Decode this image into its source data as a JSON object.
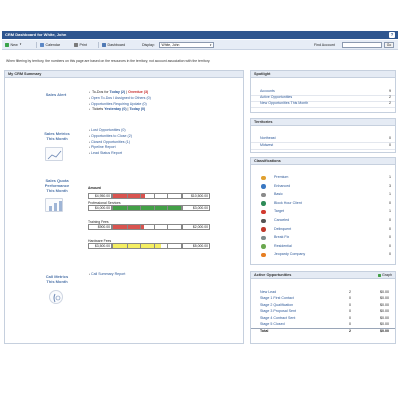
{
  "window": {
    "title": "CRM Dashboard for White, John"
  },
  "toolbar": {
    "new_label": "New",
    "calendar_label": "Calendar",
    "print_label": "Print",
    "dashboard_label": "Dashboard",
    "display_label": "Display:",
    "display_value": "White, John",
    "find_account_label": "Find Account",
    "find_account_value": "",
    "go_label": "Go"
  },
  "notice": "When filtering by territory, the numbers on this page are based on the resources in the territory, not account association with the territory.",
  "summary": {
    "title": "My CRM Summary",
    "sales_alert": {
      "title": "Sales Alert",
      "todo_label": "To-Dos for",
      "today_text": "Today (2)",
      "overdue_text": "Overdue (3)",
      "items": [
        "Open To-Dos I Assigned to Others (0)",
        "Opportunities Requiring Update (0)"
      ],
      "tickets_label": "Tickets",
      "tickets_yesterday": "Yesterday (0)",
      "tickets_today": "Today (0)"
    },
    "sales_metrics": {
      "title_line1": "Sales Metrics",
      "title_line2": "This Month",
      "items": [
        "Lost Opportunities (0)",
        "Opportunities to Close (2)",
        "Closed Opportunities (1)",
        "Pipeline Report",
        "Lead Status Report"
      ]
    },
    "sales_quota": {
      "title_line1": "Sales Quota",
      "title_line2": "Performance",
      "title_line3": "This Month",
      "amount_label": "Amount",
      "rows": [
        {
          "label": "",
          "actual": "$4,950.00",
          "target": "$10,500.00",
          "fraction": 0.47,
          "color": "#d9534f"
        },
        {
          "label": "Professional Services",
          "actual": "$4,000.00",
          "target": "$3,000.00",
          "fraction": 1.0,
          "color": "#43a047"
        },
        {
          "label": "Training Fees",
          "actual": "$900.00",
          "target": "$2,000.00",
          "fraction": 0.45,
          "color": "#d9534f"
        },
        {
          "label": "Hardware Fees",
          "actual": "$3,500.00",
          "target": "$5,000.00",
          "fraction": 0.7,
          "color": "#f4ee62"
        }
      ]
    },
    "call_metrics": {
      "title_line1": "Call Metrics",
      "title_line2": "This Month",
      "items": [
        "Call Summary Report"
      ]
    }
  },
  "spotlight": {
    "title": "Spotlight",
    "rows": [
      {
        "label": "Accounts",
        "value": "9"
      },
      {
        "label": "Active Opportunities",
        "value": "2"
      },
      {
        "label": "New Opportunities This Month",
        "value": "2"
      }
    ]
  },
  "territories": {
    "title": "Territories",
    "rows": [
      {
        "label": "Northeast",
        "value": "0"
      },
      {
        "label": "Midwest",
        "value": "0"
      }
    ]
  },
  "classifications": {
    "title": "Classifications",
    "rows": [
      {
        "label": "Premium",
        "value": "1",
        "icon": "premium-icon",
        "color": "#e0a030"
      },
      {
        "label": "Enhanced",
        "value": "3",
        "icon": "enhanced-icon",
        "color": "#3a78c2"
      },
      {
        "label": "Basic",
        "value": "1",
        "icon": "basic-icon",
        "color": "#8a8a8a"
      },
      {
        "label": "Block Hour Client",
        "value": "0",
        "icon": "block-hour-icon",
        "color": "#2e8b57"
      },
      {
        "label": "Target",
        "value": "1",
        "icon": "target-icon",
        "color": "#d23a2f"
      },
      {
        "label": "Canceled",
        "value": "0",
        "icon": "canceled-icon",
        "color": "#555555"
      },
      {
        "label": "Delinquent",
        "value": "0",
        "icon": "delinquent-icon",
        "color": "#c0392b"
      },
      {
        "label": "Break Fix",
        "value": "0",
        "icon": "break-fix-icon",
        "color": "#7f8c8d"
      },
      {
        "label": "Residential",
        "value": "0",
        "icon": "residential-icon",
        "color": "#6aa84f"
      },
      {
        "label": "Jeopardy Company",
        "value": "0",
        "icon": "jeopardy-icon",
        "color": "#e67e22"
      }
    ]
  },
  "active_opportunities": {
    "title": "Active Opportunities",
    "graph_label": "Graph",
    "rows": [
      {
        "label": "New Lead",
        "count": "2",
        "amount": "$0.00"
      },
      {
        "label": "Stage 1 First Contact",
        "count": "0",
        "amount": "$0.00"
      },
      {
        "label": "Stage 2 Qualification",
        "count": "0",
        "amount": "$0.00"
      },
      {
        "label": "Stage 3 Proposal Sent",
        "count": "0",
        "amount": "$0.00"
      },
      {
        "label": "Stage 4 Contract Sent",
        "count": "0",
        "amount": "$0.00"
      },
      {
        "label": "Stage 5 Closed",
        "count": "0",
        "amount": "$0.00"
      }
    ],
    "total_label": "Total",
    "total_count": "2",
    "total_amount": "$0.00"
  }
}
